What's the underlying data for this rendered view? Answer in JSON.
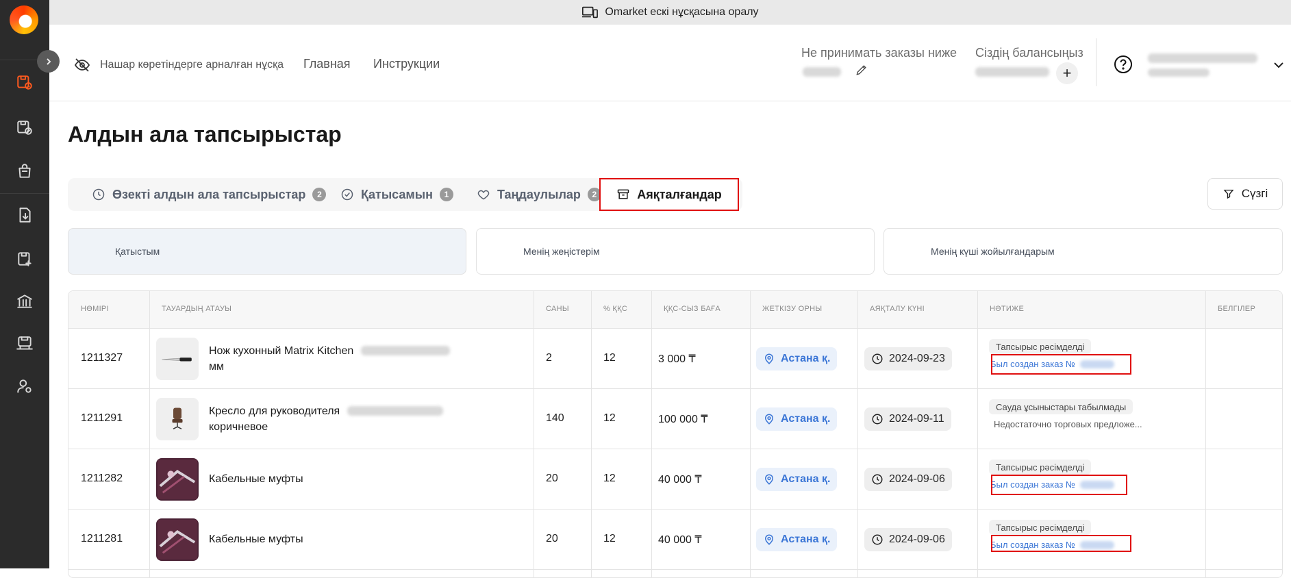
{
  "banner": {
    "text": "Omarket ескі нұсқасына оралу"
  },
  "header": {
    "accessibility_label": "Нашар көретіндерге арналған нұсқа",
    "nav": [
      "Главная",
      "Инструкции"
    ],
    "min_order_label": "Не принимать заказы ниже",
    "balance_label": "Сіздің балансыңыз",
    "plus": "+"
  },
  "page": {
    "title": "Алдын ала тапсырыстар"
  },
  "tabs": [
    {
      "label": "Өзекті алдын ала тапсырыстар",
      "count": "2",
      "icon": "clock-icon"
    },
    {
      "label": "Қатысамын",
      "count": "1",
      "icon": "check-circle-icon"
    },
    {
      "label": "Таңдаулылар",
      "count": "2",
      "icon": "heart-icon"
    },
    {
      "label": "Аяқталғандар",
      "icon": "archive-icon"
    }
  ],
  "filter": {
    "label": "Сүзгі"
  },
  "subtabs": [
    "Қатыстым",
    "Менің жеңістерім",
    "Менің күші жойылғандарым"
  ],
  "table": {
    "headers": [
      "НӨМІРІ",
      "ТАУАРДЫҢ АТАУЫ",
      "САНЫ",
      "% ҚҚС",
      "ҚҚС-СЫЗ БАҒА",
      "ЖЕТКІЗУ ОРНЫ",
      "АЯҚТАЛУ КҮНІ",
      "НӘТИЖЕ",
      "БЕЛГІЛЕР"
    ],
    "rows": [
      {
        "number": "1211327",
        "name_line1": "Нож кухонный Matrix Kitchen",
        "name_line2": "мм",
        "qty": "2",
        "vat": "12",
        "price": "3 000 ₸",
        "location": "Астана қ.",
        "date": "2024-09-23",
        "status": "Тапсырыс рәсімделді",
        "note": "Был создан заказ №",
        "note_type": "link"
      },
      {
        "number": "1211291",
        "name_line1": "Кресло для руководителя",
        "name_line2": "коричневое",
        "qty": "140",
        "vat": "12",
        "price": "100 000 ₸",
        "location": "Астана қ.",
        "date": "2024-09-11",
        "status": "Сауда ұсыныстары табылмады",
        "note": "Недостаточно торговых предложе...",
        "note_type": "text"
      },
      {
        "number": "1211282",
        "name_line1": "Кабельные муфты",
        "name_line2": "",
        "qty": "20",
        "vat": "12",
        "price": "40 000 ₸",
        "location": "Астана қ.",
        "date": "2024-09-06",
        "status": "Тапсырыс рәсімделді",
        "note": "Был создан заказ №",
        "note_type": "link"
      },
      {
        "number": "1211281",
        "name_line1": "Кабельные муфты",
        "name_line2": "",
        "qty": "20",
        "vat": "12",
        "price": "40 000 ₸",
        "location": "Астана қ.",
        "date": "2024-09-06",
        "status": "Тапсырыс рәсімделді",
        "note": "Был создан заказ №",
        "note_type": "link"
      }
    ]
  },
  "colors": {
    "accent": "#ff5a1f",
    "link": "#3b76d6",
    "highlight": "#e01010",
    "sidebar": "#2b2b2b"
  }
}
